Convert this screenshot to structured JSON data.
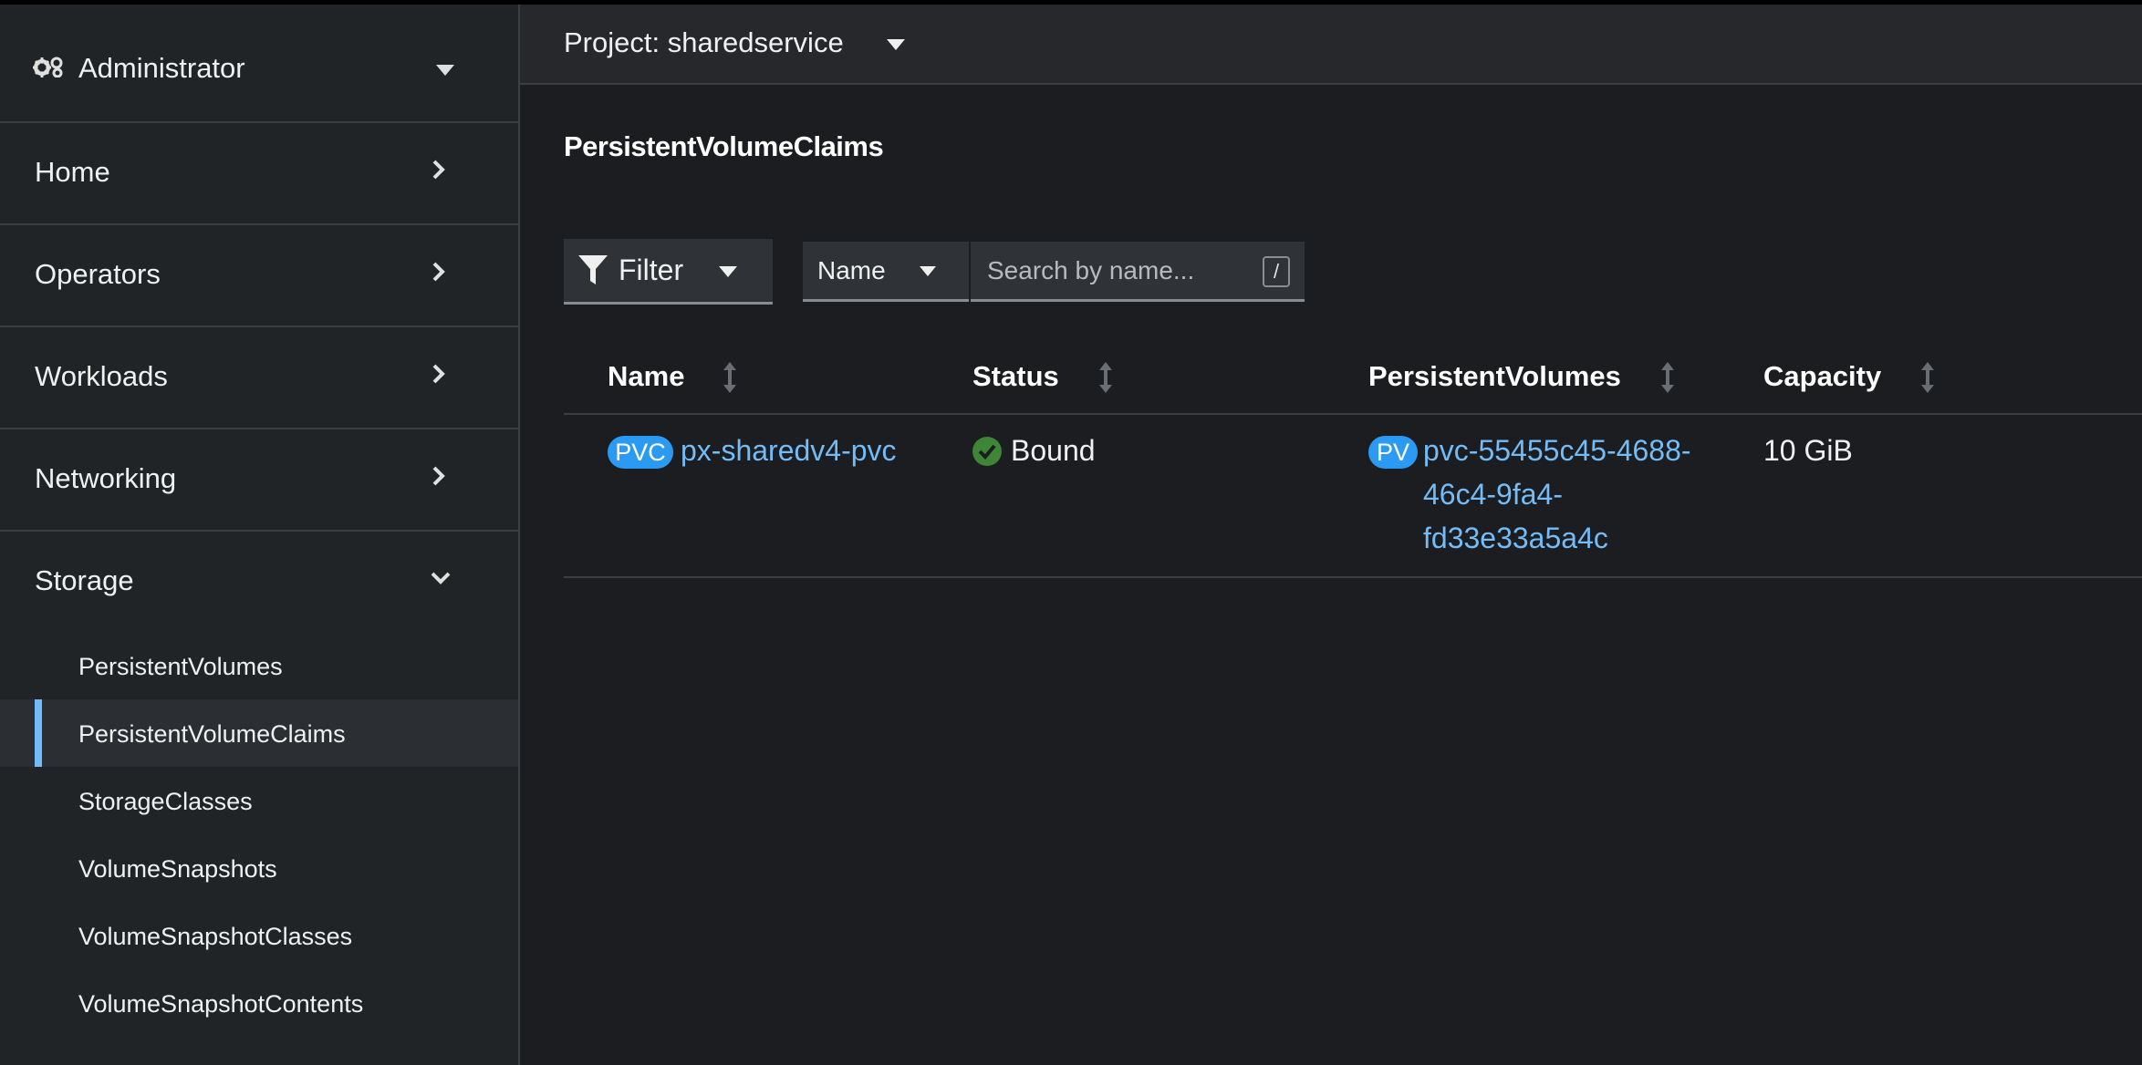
{
  "sidebar": {
    "perspective": "Administrator",
    "sections": [
      {
        "label": "Home"
      },
      {
        "label": "Operators"
      },
      {
        "label": "Workloads"
      },
      {
        "label": "Networking"
      }
    ],
    "storage": {
      "label": "Storage",
      "items": [
        {
          "label": "PersistentVolumes"
        },
        {
          "label": "PersistentVolumeClaims",
          "active": true
        },
        {
          "label": "StorageClasses"
        },
        {
          "label": "VolumeSnapshots"
        },
        {
          "label": "VolumeSnapshotClasses"
        },
        {
          "label": "VolumeSnapshotContents"
        }
      ]
    }
  },
  "project": {
    "label": "Project: sharedservice"
  },
  "page": {
    "title": "PersistentVolumeClaims"
  },
  "toolbar": {
    "filter_label": "Filter",
    "name_select": "Name",
    "search_placeholder": "Search by name...",
    "search_shortcut": "/"
  },
  "table": {
    "columns": [
      "Name",
      "Status",
      "PersistentVolumes",
      "Capacity"
    ],
    "rows": [
      {
        "name_badge": "PVC",
        "name": "px-sharedv4-pvc",
        "status": "Bound",
        "pv_badge": "PV",
        "pv_lines": [
          "pvc-55455c45-4688-",
          "46c4-9fa4-",
          "fd33e33a5a4c"
        ],
        "capacity": "10 GiB"
      }
    ]
  },
  "colors": {
    "accent": "#73bcf7",
    "badge": "#2b9af3",
    "success": "#3e8635",
    "background": "#1b1d21"
  }
}
